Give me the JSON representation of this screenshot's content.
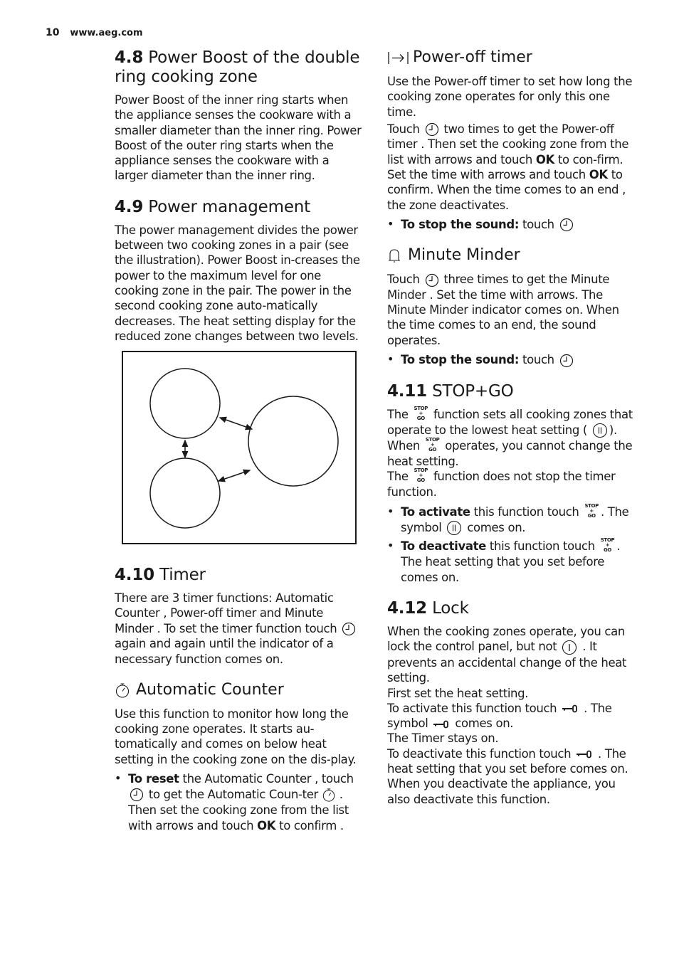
{
  "header": {
    "page_number": "10",
    "url": "www.aeg.com"
  },
  "left": {
    "s48": {
      "num": "4.8",
      "title": " Power Boost of the double ring cooking zone",
      "body": "Power Boost of the inner ring starts when the appliance senses the cookware with a smaller diameter than the inner ring. Power Boost of the outer ring starts when the appliance senses the cookware with a larger diameter than the inner ring."
    },
    "s49": {
      "num": "4.9",
      "title": " Power management",
      "body": "The power management divides the power between two cooking zones in a pair (see the illustration). Power Boost in-creases the power to the maximum level for one cooking zone in the pair. The power in the second cooking zone auto-matically decreases. The heat setting display for the reduced zone changes between two levels."
    },
    "s410": {
      "num": "4.10",
      "title": " Timer",
      "body_a": "There are 3 timer functions: Automatic Counter , Power-off timer and Minute Minder . To set the timer function touch",
      "body_b": "again and again until the indicator of a necessary function comes on."
    },
    "auto_counter": {
      "icon": "stopwatch-icon",
      "title": "Automatic Counter",
      "body": "Use this function to monitor how long the cooking zone operates. It starts au-tomatically and comes on below heat setting in the cooking zone on the dis-play.",
      "bullet": {
        "bold": "To reset",
        "a": " the Automatic Counter , touch",
        "b": "to get the Automatic Coun-ter",
        "c": ". Then set the cooking zone from the list with arrows and touch ",
        "ok": "OK",
        "d": " to confirm ."
      }
    }
  },
  "right": {
    "power_off": {
      "icon": "power-off-timer-icon",
      "title": "Power-off timer",
      "body1": "Use the Power-off timer to set how long the cooking zone operates for only this one time.",
      "body2_a": "Touch",
      "body2_b": "two times to get the Power-off timer . Then set the cooking zone from the list with arrows and touch ",
      "ok1": "OK",
      "body2_c": " to con-firm. Set the time with arrows and touch ",
      "ok2": "OK",
      "body2_d": " to confirm. When the time comes to an end , the zone deactivates.",
      "bullet_bold": "To stop the sound:",
      "bullet_text": " touch"
    },
    "minute_minder": {
      "icon": "bell-icon",
      "title": "Minute Minder",
      "body_a": "Touch",
      "body_b": "three times to get the Minute Minder . Set the time with arrows. The Minute Minder indicator comes on. When the time comes to an end, the sound operates.",
      "bullet_bold": "To stop the sound:",
      "bullet_text": " touch"
    },
    "s411": {
      "num": "4.11",
      "title": " STOP+GO",
      "stopgo_top": "STOP",
      "stopgo_mid": "+",
      "stopgo_bot": "GO",
      "p1_a": "The",
      "p1_b": "function sets all cooking zones that operate to the lowest heat setting (",
      "p1_c": ").",
      "p2_a": "When",
      "p2_b": "operates, you cannot change the heat setting.",
      "p3_a": "The",
      "p3_b": "function does not stop the timer function.",
      "b1_bold": "To activate",
      "b1_a": " this function touch",
      "b1_b": ". The symbol",
      "b1_c": "comes on.",
      "b2_bold": "To deactivate",
      "b2_a": " this function touch",
      "b2_b": ". The heat setting that you set before comes on."
    },
    "s412": {
      "num": "4.12",
      "title": " Lock",
      "p1_a": "When the cooking zones operate, you can lock the control panel, but not",
      "p1_b": ". It prevents an accidental change of the heat setting.",
      "p2": "First set the heat setting.",
      "p3_a": "To activate this function touch",
      "p3_b": ". The symbol",
      "p3_c": "comes on.",
      "p4": "The Timer stays on.",
      "p5_a": "To deactivate this function touch",
      "p5_b": ". The heat setting that you set before comes on.",
      "p6": "When you deactivate the appliance, you also deactivate this function."
    }
  }
}
